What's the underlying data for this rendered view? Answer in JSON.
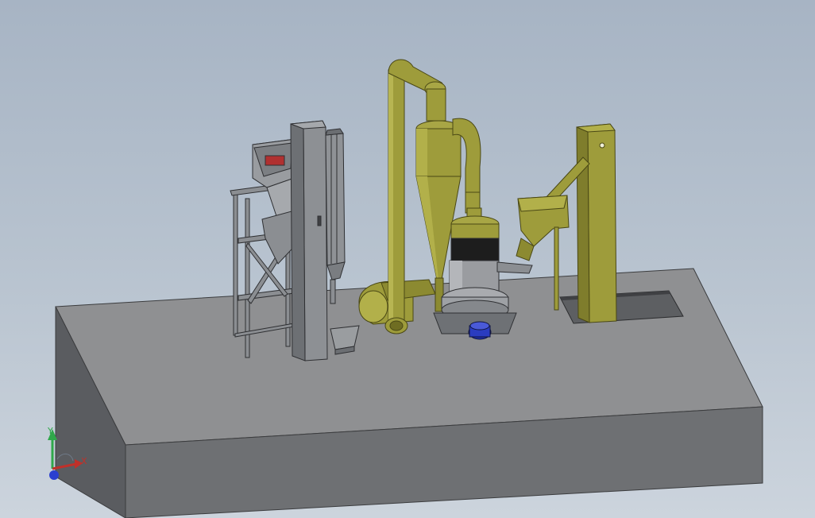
{
  "viewport": {
    "background_top": "#a7b4c4",
    "background_bottom": "#ccd4dd"
  },
  "colors": {
    "equipment_olive": "#9e9c3b",
    "equipment_olive_dark": "#6f6d22",
    "steel_gray": "#8b8e92",
    "base_top": "#8f9092",
    "base_front": "#6e7073",
    "base_side": "#5a5c60",
    "motor_blue": "#1f2fa8",
    "roller_dark": "#2a2a2a",
    "accent_red": "#b03030"
  },
  "triad": {
    "x_label": "X",
    "y_label": "Y",
    "x_color": "#c0302a",
    "y_color": "#2fa84a",
    "z_color": "#2a3fd0"
  },
  "components": [
    "base-platform",
    "feed-hopper",
    "support-frame",
    "dust-collector",
    "bucket-elevator-left",
    "cyclone-separator",
    "air-duct",
    "blower-fan",
    "grinding-mill",
    "drive-motor",
    "bucket-elevator-right",
    "elevator-pit"
  ]
}
